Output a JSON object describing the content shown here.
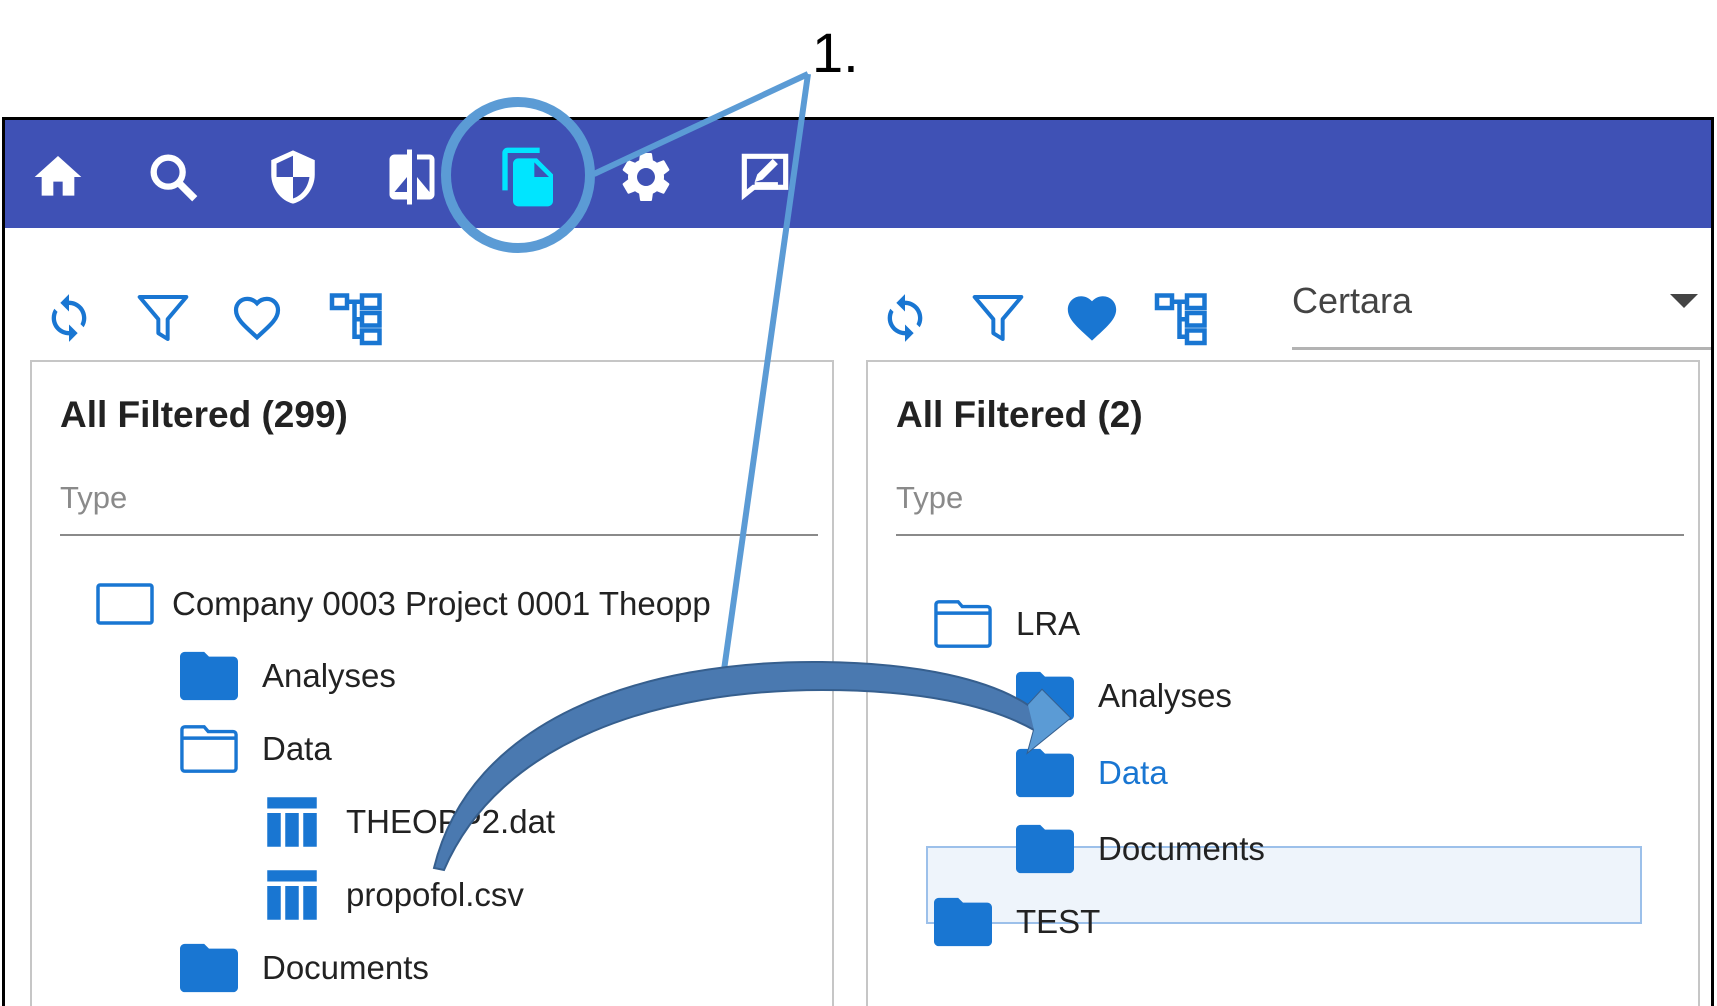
{
  "annotation": {
    "step_number": "1."
  },
  "navbar": {
    "icons": [
      "home-icon",
      "search-icon",
      "shield-icon",
      "compare-icon",
      "documents-icon",
      "settings-icon",
      "signature-icon"
    ],
    "active": "documents-icon",
    "background": "#3f51b5",
    "active_color": "#00e5ff"
  },
  "left_panel": {
    "title": "All Filtered (299)",
    "type_label": "Type",
    "toolbar": [
      "refresh-icon",
      "filter-icon",
      "favorite-outline-icon",
      "tree-view-icon"
    ],
    "tree": [
      {
        "label": "Company 0003 Project 0001 Theopp",
        "icon": "project-icon"
      },
      {
        "label": "Analyses",
        "icon": "folder-filled-icon"
      },
      {
        "label": "Data",
        "icon": "folder-outline-icon"
      },
      {
        "label": "THEOPP2.dat",
        "icon": "table-file-icon"
      },
      {
        "label": "propofol.csv",
        "icon": "table-file-icon"
      },
      {
        "label": "Documents",
        "icon": "folder-filled-icon"
      }
    ]
  },
  "right_panel": {
    "title": "All Filtered (2)",
    "type_label": "Type",
    "toolbar": [
      "refresh-icon",
      "filter-icon",
      "favorite-filled-icon",
      "tree-view-icon"
    ],
    "dropdown_value": "Certara",
    "tree": [
      {
        "label": "LRA",
        "icon": "folder-outline-icon"
      },
      {
        "label": "Analyses",
        "icon": "folder-filled-icon"
      },
      {
        "label": "Data",
        "icon": "folder-filled-icon",
        "selected": true
      },
      {
        "label": "Documents",
        "icon": "folder-filled-icon"
      },
      {
        "label": "TEST",
        "icon": "folder-filled-icon"
      }
    ]
  },
  "colors": {
    "accent_blue": "#1976d2",
    "annotation_blue": "#5b9bd5",
    "drag_arrow": "#4472a8"
  }
}
